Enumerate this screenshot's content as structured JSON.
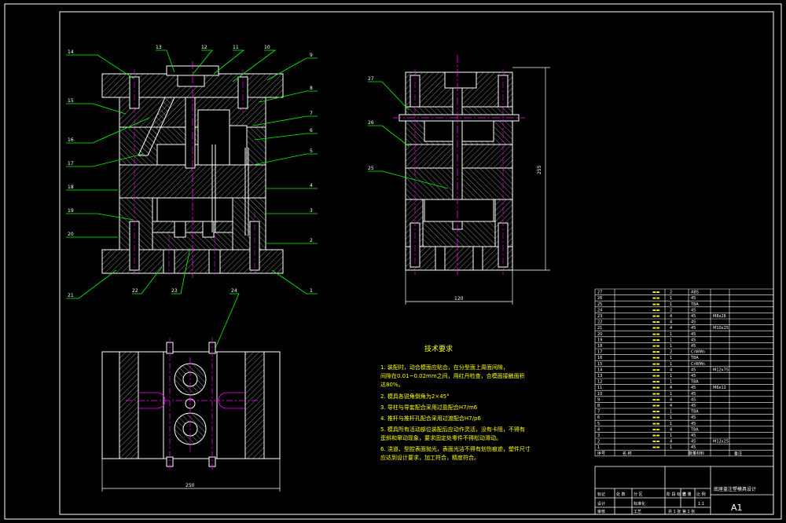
{
  "colors": {
    "background": "#000000",
    "frame": "#ffffff",
    "leader": "#00ff00",
    "part": "#ffffff",
    "hatch": "#bbbbbb",
    "centerline": "#ff00ff",
    "dimension": "#ffffff",
    "text_yellow": "#ffff00",
    "table_line": "#ffffff"
  },
  "front_view_labels": {
    "left": [
      "14",
      "15",
      "16",
      "17",
      "18",
      "19",
      "20",
      "21"
    ],
    "top": [
      "13",
      "12",
      "11",
      "10"
    ],
    "right": [
      "9",
      "8",
      "7",
      "6",
      "5",
      "4",
      "3",
      "2",
      "1"
    ],
    "bottom": [
      "22",
      "23",
      "24"
    ]
  },
  "side_view_labels": [
    "27",
    "26",
    "25"
  ],
  "dimensions": {
    "side_height": "255",
    "side_width": "120",
    "plan_width": "250"
  },
  "tech_requirements": {
    "title": "技术要求",
    "items": [
      "1. 装配时，动合模面应贴合，在分型面上周面间隙，",
      "间隙在0.01~0.02mm之间，用红丹检查，合模面接触面积",
      "达80%。",
      "2. 模具各锐角倒角为2×45°",
      "3. 导柱与导套配合采用过盈配合H7/m6",
      "4. 推杆与推杆孔配合采用过渡配合H7/p6",
      "5. 模具所有活动部位装配后应动作灵活，没有卡阻，不得有",
      "歪斜和窜动现象，要求固定处零件不得松动滑动。",
      "6. 浇道、型腔表面抛光，表面光洁不得有划伤痕迹，塑件尺寸",
      "应达到设计要求，加工符合，精度符合。"
    ]
  },
  "bom": {
    "rows": [
      {
        "no": "27",
        "qty": "2",
        "mat": "ABS",
        "note": ""
      },
      {
        "no": "26",
        "qty": "1",
        "mat": "45",
        "note": ""
      },
      {
        "no": "25",
        "qty": "1",
        "mat": "T8A",
        "note": ""
      },
      {
        "no": "24",
        "qty": "2",
        "mat": "45",
        "note": ""
      },
      {
        "no": "23",
        "qty": "4",
        "mat": "45",
        "note": "M8x26"
      },
      {
        "no": "22",
        "qty": "4",
        "mat": "45",
        "note": ""
      },
      {
        "no": "21",
        "qty": "4",
        "mat": "45",
        "note": "M10x25"
      },
      {
        "no": "20",
        "qty": "1",
        "mat": "45",
        "note": ""
      },
      {
        "no": "19",
        "qty": "1",
        "mat": "45",
        "note": ""
      },
      {
        "no": "18",
        "qty": "1",
        "mat": "45",
        "note": ""
      },
      {
        "no": "17",
        "qty": "2",
        "mat": "CrWMn",
        "note": ""
      },
      {
        "no": "16",
        "qty": "1",
        "mat": "T8A",
        "note": ""
      },
      {
        "no": "15",
        "qty": "1",
        "mat": "CrWMn",
        "note": ""
      },
      {
        "no": "14",
        "qty": "4",
        "mat": "45",
        "note": "M12x75"
      },
      {
        "no": "13",
        "qty": "1",
        "mat": "45",
        "note": ""
      },
      {
        "no": "12",
        "qty": "1",
        "mat": "T8A",
        "note": ""
      },
      {
        "no": "11",
        "qty": "4",
        "mat": "45",
        "note": "M6x12"
      },
      {
        "no": "10",
        "qty": "1",
        "mat": "45",
        "note": ""
      },
      {
        "no": "9",
        "qty": "4",
        "mat": "45",
        "note": ""
      },
      {
        "no": "8",
        "qty": "4",
        "mat": "45",
        "note": ""
      },
      {
        "no": "7",
        "qty": "1",
        "mat": "T8A",
        "note": ""
      },
      {
        "no": "6",
        "qty": "1",
        "mat": "45",
        "note": ""
      },
      {
        "no": "5",
        "qty": "1",
        "mat": "45",
        "note": ""
      },
      {
        "no": "4",
        "qty": "4",
        "mat": "T8A",
        "note": ""
      },
      {
        "no": "3",
        "qty": "1",
        "mat": "45",
        "note": ""
      },
      {
        "no": "2",
        "qty": "4",
        "mat": "45",
        "note": "M12x25"
      },
      {
        "no": "1",
        "qty": "1",
        "mat": "45",
        "note": ""
      }
    ],
    "header": {
      "no": "序号",
      "name": "名 称",
      "qty": "数量",
      "mat": "材料",
      "note": "备注"
    },
    "footer_left": [
      "标记",
      "处 数",
      "分 区",
      "更改文件号",
      "签 名",
      "年 月 日"
    ],
    "footer_row2": [
      "设计",
      "标准化"
    ],
    "footer_row3": [
      "审核",
      "工艺",
      "批准"
    ],
    "stage_labels": [
      "阶 段 标 记",
      "重 量",
      "比 例"
    ],
    "scale": "1:1",
    "sheet": "共 1 张   第 1 张",
    "drawing_title": "底座盖注塑模具设计",
    "sheet_size": "A1"
  }
}
